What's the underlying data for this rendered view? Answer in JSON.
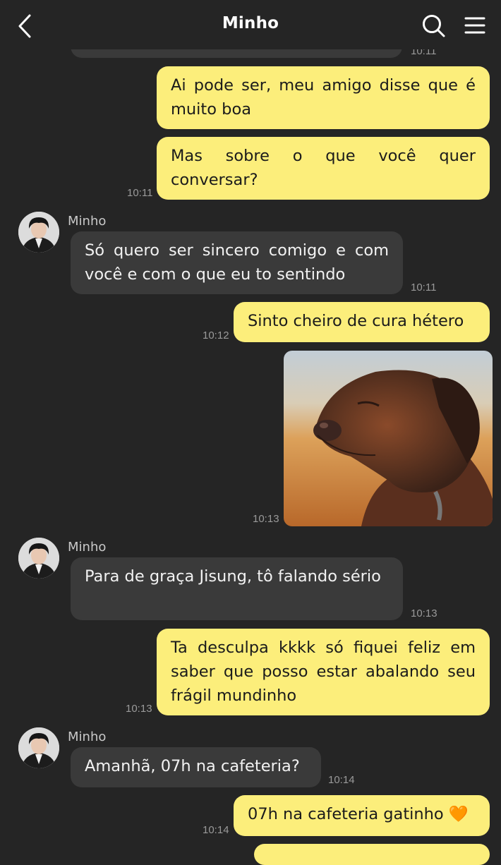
{
  "header": {
    "title": "Minho"
  },
  "messages": {
    "m0": {
      "time": "10:11"
    },
    "m1": {
      "text": "Ai pode ser, meu amigo disse que é muito boa"
    },
    "m2": {
      "text": "Mas sobre o que você quer conversar?",
      "time": "10:11"
    },
    "m3": {
      "sender": "Minho",
      "text": "Só quero ser sincero comigo e com você e com o que eu to sentindo",
      "time": "10:11"
    },
    "m4": {
      "text": "Sinto cheiro de cura hétero",
      "time": "10:12"
    },
    "m5": {
      "time": "10:13"
    },
    "m6": {
      "sender": "Minho",
      "text": "Para de graça Jisung, tô falando sério",
      "time": "10:13"
    },
    "m7": {
      "text": "Ta desculpa kkkk só fiquei feliz em saber que posso estar abalando seu frágil mundinho",
      "time": "10:13"
    },
    "m8": {
      "sender": "Minho",
      "text": "Amanhã, 07h na cafeteria?",
      "time": "10:14"
    },
    "m9": {
      "text": "07h na cafeteria gatinho 🧡",
      "time": "10:14"
    }
  },
  "colors": {
    "background": "#252525",
    "outgoing_bubble": "#fcee7b",
    "incoming_bubble": "#3a3a3a",
    "timestamp": "#9a9a9a"
  },
  "icons": [
    "back-arrow-icon",
    "search-icon",
    "menu-icon",
    "dog-photo"
  ]
}
